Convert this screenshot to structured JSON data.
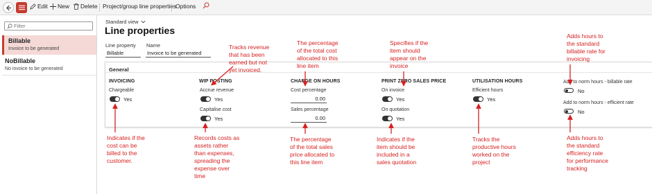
{
  "toolbar": {
    "edit": "Edit",
    "new": "New",
    "delete": "Delete",
    "project_group": "Project/group line properties",
    "options": "Options"
  },
  "filter": {
    "placeholder": "Filter"
  },
  "list": [
    {
      "title": "Billable",
      "subtitle": "Invoice to be generated",
      "selected": true
    },
    {
      "title": "NoBillable",
      "subtitle": "No invoice to be generated",
      "selected": false
    }
  ],
  "header": {
    "view": "Standard view",
    "title": "Line properties",
    "line_property_label": "Line property",
    "line_property_value": "Billable",
    "name_label": "Name",
    "name_value": "Invoice to be generated"
  },
  "general": {
    "title": "General",
    "invoicing": {
      "heading": "INVOICING",
      "chargeable_label": "Chargeable",
      "chargeable_value": "Yes",
      "chargeable_on": true
    },
    "wip": {
      "heading": "WIP POSTING",
      "accrue_label": "Accrue revenue",
      "accrue_value": "Yes",
      "accrue_on": true,
      "capitalise_label": "Capitalise cost",
      "capitalise_value": "Yes",
      "capitalise_on": true
    },
    "charges": {
      "heading": "CHARGE ON HOURS",
      "cost_label": "Cost percentage",
      "cost_value": "0.00",
      "sales_label": "Sales percentage",
      "sales_value": "0.00"
    },
    "print": {
      "heading": "PRINT ZERO SALES PRICE",
      "invoice_label": "On invoice",
      "invoice_value": "Yes",
      "invoice_on": true,
      "quotation_label": "On quotation",
      "quotation_value": "Yes",
      "quotation_on": true
    },
    "utilisation": {
      "heading": "UTILISATION HOURS",
      "efficient_label": "Efficient hours",
      "efficient_value": "Yes",
      "efficient_on": true
    },
    "norm": {
      "billable_label": "Add to norm hours - billable rate",
      "billable_value": "No",
      "billable_on": false,
      "efficient_label": "Add to norm hours - efficient rate",
      "efficient_value": "No",
      "efficient_on": false
    }
  },
  "annotations": {
    "accrue": [
      "Tracks revenue",
      "that has been",
      "earned but not",
      "yet invoiced."
    ],
    "cost_pct": [
      "The percentage",
      "of the total cost",
      "allocated to this",
      "line item"
    ],
    "on_invoice": [
      "Specifies if the",
      "item should",
      "appear on the",
      "invoice"
    ],
    "norm_billable": [
      "Adds hours to",
      "the standard",
      "billable rate for",
      "invoicing"
    ],
    "chargeable": [
      "Indicates if the",
      "cost can be",
      "billed to the",
      "customer."
    ],
    "capitalise": [
      "Records costs as",
      "assets rather",
      "than expenses,",
      "spreading the",
      "expense over",
      "time"
    ],
    "sales_pct": [
      "The percentage",
      "of the total sales",
      "price allocated to",
      "this line item"
    ],
    "on_quotation": [
      "Indicates if the",
      "item should be",
      "included in a",
      "sales quotation"
    ],
    "efficient": [
      "Tracks the",
      "productive hours",
      "worked on the",
      "project"
    ],
    "norm_efficient": [
      "Adds hours to",
      "the standard",
      "efficiency rate",
      "for performance",
      "tracking"
    ]
  },
  "colors": {
    "accent": "#c53b31",
    "annotation": "#d61f1f",
    "selected_bg": "#f5d9d6"
  }
}
